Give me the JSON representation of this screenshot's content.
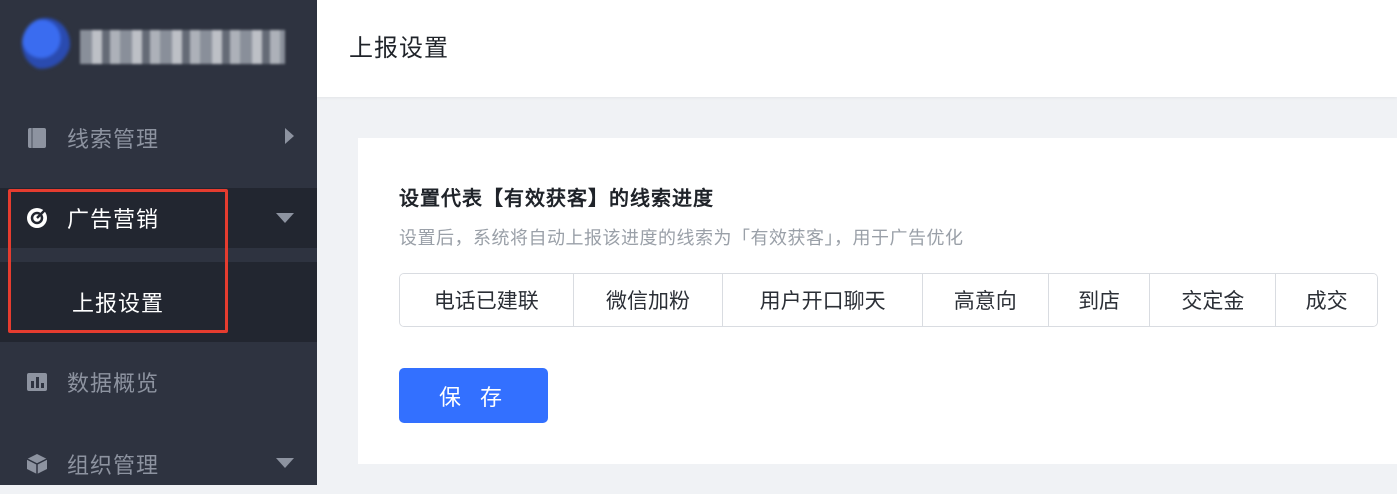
{
  "sidebar": {
    "items": [
      {
        "label": "线索管理",
        "icon": "book-icon",
        "arrow": "chevron-right-icon"
      },
      {
        "label": "广告营销",
        "icon": "target-icon",
        "arrow": "caret-down-icon",
        "active": true,
        "children": [
          {
            "label": "上报设置",
            "active": true
          }
        ]
      },
      {
        "label": "数据概览",
        "icon": "bar-chart-icon"
      },
      {
        "label": "组织管理",
        "icon": "cube-icon",
        "arrow": "caret-down-icon"
      }
    ]
  },
  "header": {
    "title": "上报设置"
  },
  "card": {
    "title": "设置代表【有效获客】的线索进度",
    "description": "设置后，系统将自动上报该进度的线索为「有效获客」，用于广告优化",
    "stages": [
      "电话已建联",
      "微信加粉",
      "用户开口聊天",
      "高意向",
      "到店",
      "交定金",
      "成交"
    ],
    "save_label": "保 存"
  },
  "colors": {
    "sidebar_bg": "#2e3340",
    "sidebar_active_bg": "#222630",
    "primary": "#3370ff",
    "highlight_border": "#e53c2f"
  }
}
